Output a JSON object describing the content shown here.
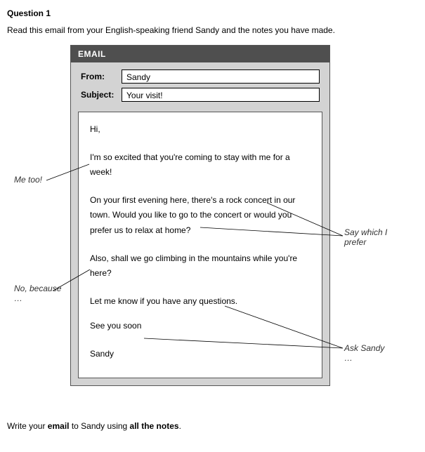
{
  "question": {
    "label": "Question 1",
    "intro": "Read this email from your English-speaking friend Sandy and the notes you have made."
  },
  "email": {
    "bar": "EMAIL",
    "from_label": "From:",
    "from_value": "Sandy",
    "subject_label": "Subject:",
    "subject_value": "Your visit!",
    "body": {
      "greeting": "Hi,",
      "p1": "I'm so excited that you're coming to stay with me for a week!",
      "p2": "On your first evening here, there's a rock concert in our town. Would you like to go to the concert or would you prefer us to relax at home?",
      "p3": "Also, shall we go climbing in the mountains while you're here?",
      "p4": "Let me know if you have any questions.",
      "p5": "See you soon",
      "signoff": "Sandy"
    }
  },
  "notes": {
    "n1": "Me too!",
    "n2": "Say which I prefer",
    "n3": "No, because …",
    "n4": "Ask Sandy …"
  },
  "final": {
    "pre": "Write your ",
    "b1": "email",
    "mid": " to Sandy using ",
    "b2": "all the notes",
    "post": "."
  }
}
